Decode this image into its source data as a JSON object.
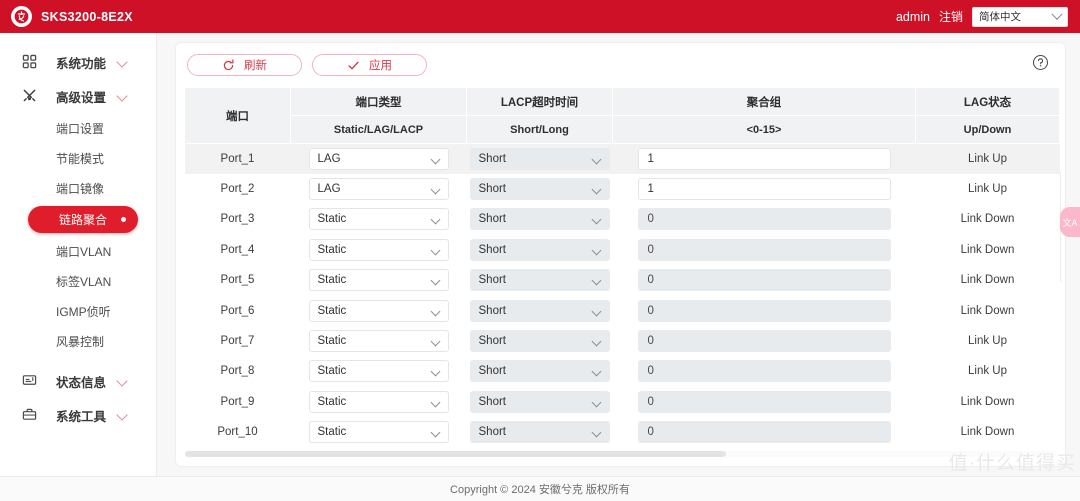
{
  "topbar": {
    "device_name": "SKS3200-8E2X",
    "admin": "admin",
    "logout": "注销",
    "language": "简体中文",
    "brand_color": "#cf1128"
  },
  "sidebar": {
    "groups": [
      {
        "icon": "grid-icon",
        "label": "系统功能",
        "expanded": false,
        "children": []
      },
      {
        "icon": "tools-icon",
        "label": "高级设置",
        "expanded": true,
        "children": [
          "端口设置",
          "节能模式",
          "端口镜像",
          "链路聚合",
          "端口VLAN",
          "标签VLAN",
          "IGMP侦听",
          "风暴控制"
        ]
      },
      {
        "icon": "monitor-icon",
        "label": "状态信息",
        "expanded": false,
        "children": []
      },
      {
        "icon": "toolbox-icon",
        "label": "系统工具",
        "expanded": false,
        "children": []
      }
    ],
    "active_child": "链路聚合"
  },
  "toolbar": {
    "refresh_label": "刷新",
    "apply_label": "应用",
    "refresh_icon": "refresh-icon",
    "apply_icon": "check-icon",
    "help_icon": "help-icon"
  },
  "table": {
    "headers": [
      {
        "title": "端口",
        "sub": ""
      },
      {
        "title": "端口类型",
        "sub": "Static/LAG/LACP"
      },
      {
        "title": "LACP超时时间",
        "sub": "Short/Long"
      },
      {
        "title": "聚合组",
        "sub": "<0-15>"
      },
      {
        "title": "LAG状态",
        "sub": "Up/Down"
      }
    ],
    "rows": [
      {
        "port": "Port_1",
        "type": "LAG",
        "type_disabled": false,
        "timeout": "Short",
        "timeout_disabled": true,
        "group": "1",
        "group_disabled": false,
        "status": "Link Up",
        "selected": true
      },
      {
        "port": "Port_2",
        "type": "LAG",
        "type_disabled": false,
        "timeout": "Short",
        "timeout_disabled": true,
        "group": "1",
        "group_disabled": false,
        "status": "Link Up",
        "selected": false
      },
      {
        "port": "Port_3",
        "type": "Static",
        "type_disabled": false,
        "timeout": "Short",
        "timeout_disabled": true,
        "group": "0",
        "group_disabled": true,
        "status": "Link Down",
        "selected": false
      },
      {
        "port": "Port_4",
        "type": "Static",
        "type_disabled": false,
        "timeout": "Short",
        "timeout_disabled": true,
        "group": "0",
        "group_disabled": true,
        "status": "Link Down",
        "selected": false
      },
      {
        "port": "Port_5",
        "type": "Static",
        "type_disabled": false,
        "timeout": "Short",
        "timeout_disabled": true,
        "group": "0",
        "group_disabled": true,
        "status": "Link Down",
        "selected": false
      },
      {
        "port": "Port_6",
        "type": "Static",
        "type_disabled": false,
        "timeout": "Short",
        "timeout_disabled": true,
        "group": "0",
        "group_disabled": true,
        "status": "Link Down",
        "selected": false
      },
      {
        "port": "Port_7",
        "type": "Static",
        "type_disabled": false,
        "timeout": "Short",
        "timeout_disabled": true,
        "group": "0",
        "group_disabled": true,
        "status": "Link Up",
        "selected": false
      },
      {
        "port": "Port_8",
        "type": "Static",
        "type_disabled": false,
        "timeout": "Short",
        "timeout_disabled": true,
        "group": "0",
        "group_disabled": true,
        "status": "Link Up",
        "selected": false
      },
      {
        "port": "Port_9",
        "type": "Static",
        "type_disabled": false,
        "timeout": "Short",
        "timeout_disabled": true,
        "group": "0",
        "group_disabled": true,
        "status": "Link Down",
        "selected": false
      },
      {
        "port": "Port_10",
        "type": "Static",
        "type_disabled": false,
        "timeout": "Short",
        "timeout_disabled": true,
        "group": "0",
        "group_disabled": true,
        "status": "Link Down",
        "selected": false
      }
    ]
  },
  "footer": {
    "copyright": "Copyright © 2024 安徽兮克 版权所有"
  },
  "widgets": {
    "translate_glyph": "文A",
    "watermark": "值·什么值得买"
  }
}
